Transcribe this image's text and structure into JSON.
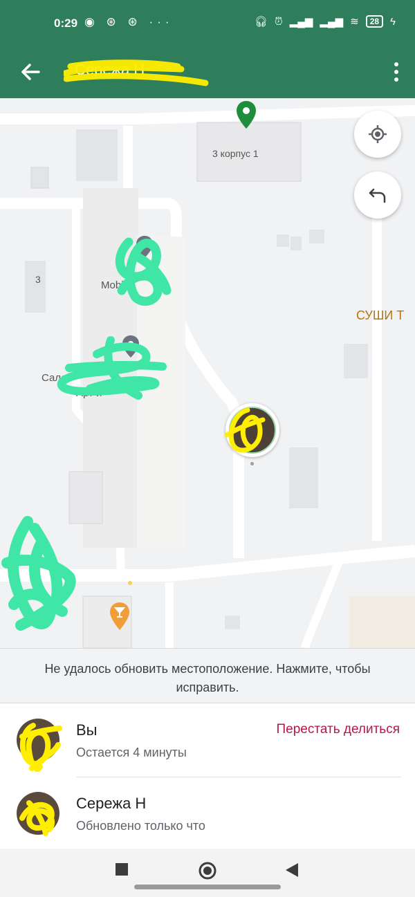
{
  "status_bar": {
    "time": "0:29",
    "left_icons": "◉ ⊛ ⊛ ···",
    "battery": "28"
  },
  "app_bar": {
    "title": "Сережа Н"
  },
  "map": {
    "labels": {
      "building": "3 корпус 1",
      "number_3": "3",
      "place_1": "Mobil",
      "place_2": "Салон",
      "place_2b": "Арт и",
      "sushi": "СУШИ Т"
    }
  },
  "banner": {
    "text": "Не удалось обновить местоположение. Нажмите, чтобы исправить."
  },
  "people": [
    {
      "name": "Вы",
      "status": "Остается 4 минуты",
      "action": "Перестать делиться"
    },
    {
      "name": "Сережа Н",
      "status": "Обновлено только что"
    }
  ],
  "colors": {
    "app_bar": "#2e7d5b",
    "stop_action": "#b31a46",
    "highlighter_yellow": "#ffee00",
    "highlighter_green": "#3fe6a6"
  }
}
